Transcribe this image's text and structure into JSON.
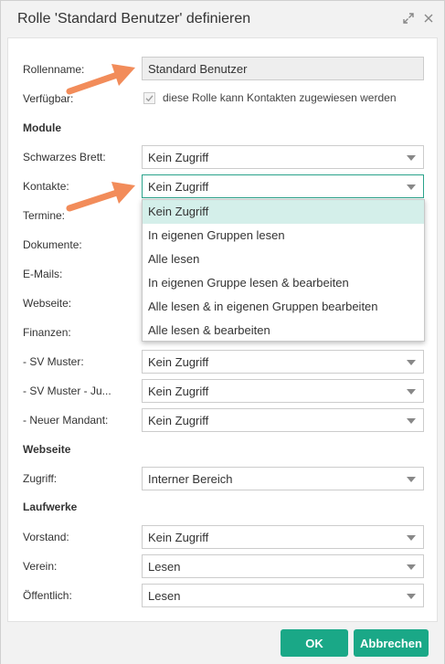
{
  "title": "Rolle 'Standard Benutzer' definieren",
  "form": {
    "rollenname_label": "Rollenname:",
    "rollenname_value": "Standard Benutzer",
    "verfuegbar_label": "Verfügbar:",
    "verfuegbar_checkbox_label": "diese Rolle kann Kontakten zugewiesen werden",
    "verfuegbar_checked": true
  },
  "sections": {
    "module": "Module",
    "webseite": "Webseite",
    "laufwerke": "Laufwerke"
  },
  "module_rows": [
    {
      "label": "Schwarzes Brett:",
      "value": "Kein Zugriff"
    },
    {
      "label": "Kontakte:",
      "value": "Kein Zugriff"
    },
    {
      "label": "Termine:"
    },
    {
      "label": "Dokumente:"
    },
    {
      "label": "E-Mails:"
    },
    {
      "label": "Webseite:"
    },
    {
      "label": "Finanzen:"
    },
    {
      "label": "- SV Muster:",
      "value": "Kein Zugriff"
    },
    {
      "label": "- SV Muster - Ju...",
      "value": "Kein Zugriff"
    },
    {
      "label": "- Neuer Mandant:",
      "value": "Kein Zugriff"
    }
  ],
  "dropdown_options": [
    "Kein Zugriff",
    "In eigenen Gruppen lesen",
    "Alle lesen",
    "In eigenen Gruppe lesen & bearbeiten",
    "Alle lesen & in eigenen Gruppen bearbeiten",
    "Alle lesen & bearbeiten"
  ],
  "dropdown_selected": "Kein Zugriff",
  "webseite_rows": [
    {
      "label": "Zugriff:",
      "value": "Interner Bereich"
    }
  ],
  "laufwerke_rows": [
    {
      "label": "Vorstand:",
      "value": "Kein Zugriff"
    },
    {
      "label": "Verein:",
      "value": "Lesen"
    },
    {
      "label": "Öffentlich:",
      "value": "Lesen"
    }
  ],
  "buttons": {
    "ok": "OK",
    "cancel": "Abbrechen"
  },
  "colors": {
    "accent": "#1aa887",
    "focus_border": "#2aa38b",
    "selected_option": "#d4efea",
    "annotation_arrow": "#f28c5a"
  },
  "icons": {
    "expand": "expand-icon",
    "close": "close-icon",
    "check": "checkmark-icon",
    "caret": "caret-down-icon",
    "annotation": "annotation-arrow-icon"
  }
}
